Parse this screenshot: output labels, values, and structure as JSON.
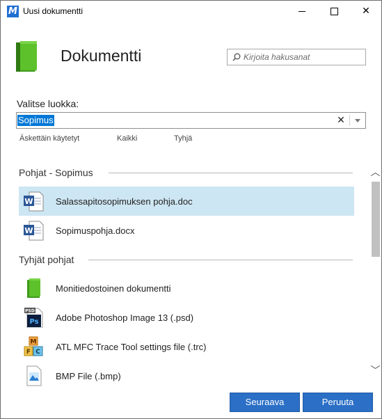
{
  "window": {
    "title": "Uusi dokumentti",
    "app_icon_letter": "M"
  },
  "header": {
    "title": "Dokumentti",
    "icon": "green-book-icon"
  },
  "search": {
    "placeholder": "Kirjoita hakusanat",
    "value": ""
  },
  "category": {
    "label": "Valitse luokka:",
    "value": "Sopimus",
    "filters": [
      "Äskettäin käytetyt",
      "Kaikki",
      "Tyhjä"
    ]
  },
  "sections": [
    {
      "title": "Pohjat - Sopimus",
      "items": [
        {
          "label": "Salassapitosopimuksen pohja.doc",
          "icon": "word-doc-icon",
          "selected": true
        },
        {
          "label": "Sopimuspohja.docx",
          "icon": "word-doc-icon",
          "selected": false
        }
      ]
    },
    {
      "title": "Tyhjät pohjat",
      "items": [
        {
          "label": "Monitiedostoinen dokumentti",
          "icon": "green-book-icon",
          "selected": false
        },
        {
          "label": "Adobe Photoshop Image 13 (.psd)",
          "icon": "photoshop-file-icon",
          "badge": "PSD",
          "glyph": "Ps",
          "selected": false
        },
        {
          "label": "ATL MFC Trace Tool settings file (.trc)",
          "icon": "mfc-blocks-icon",
          "selected": false
        },
        {
          "label": "BMP File (.bmp)",
          "icon": "image-file-icon",
          "selected": false
        }
      ]
    }
  ],
  "buttons": {
    "next": "Seuraava",
    "cancel": "Peruuta"
  },
  "colors": {
    "accent": "#2b6fc6",
    "selection": "#cde6f3",
    "highlight": "#0078d7"
  }
}
